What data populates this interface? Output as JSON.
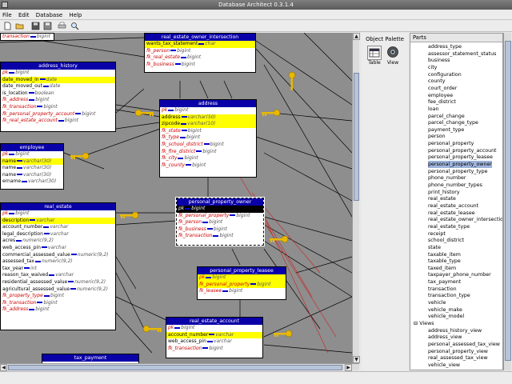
{
  "window": {
    "title": "Database Architect 0.3.1.4"
  },
  "menu": [
    "File",
    "Edit",
    "Database",
    "Help"
  ],
  "palette": {
    "title": "Object Palette",
    "items": [
      {
        "label": "Table",
        "icon": "table-icon"
      },
      {
        "label": "View",
        "icon": "view-icon"
      }
    ]
  },
  "tree": {
    "header": "Parts",
    "tables": [
      "address_type",
      "assessor_statement_status",
      "business",
      "city",
      "configuration",
      "county",
      "court_order",
      "employee",
      "fee_district",
      "loan",
      "parcel_change",
      "parcel_change_type",
      "payment_type",
      "person",
      "personal_property",
      "personal_property_account",
      "personal_property_leasee",
      "personal_property_owner",
      "personal_property_type",
      "phone_number",
      "phone_number_types",
      "print_history",
      "real_estate",
      "real_estate_account",
      "real_estate_leasee",
      "real_estate_owner_intersection",
      "real_estate_type",
      "receipt",
      "school_district",
      "state",
      "taxable_item",
      "taxable_type",
      "taxed_item",
      "taxpayer_phone_number",
      "tax_payment",
      "transaction",
      "transaction_type",
      "vehicle",
      "vehicle_make",
      "vehicle_model"
    ],
    "selected": "personal_property_owner",
    "views_label": "Views",
    "views": [
      "address_history_view",
      "address_view",
      "personal_assessed_tax_view",
      "personal_property_view",
      "real_assessed_tax_view",
      "vehicle_view"
    ]
  },
  "diagram": {
    "tables": [
      {
        "id": "top-left",
        "title": "",
        "rows": [
          {
            "n": "transaction",
            "t": "bigint",
            "k": "fk"
          }
        ]
      },
      {
        "id": "real_estate_owner_intersection",
        "title": "real_estate_owner_intersection",
        "rows": [
          {
            "n": "wants_tax_statement",
            "t": "char",
            "k": "",
            "y": true
          },
          {
            "n": "fk_person",
            "t": "bigint",
            "k": "fk"
          },
          {
            "n": "fk_real_estate",
            "t": "bigint",
            "k": "fk"
          },
          {
            "n": "fk_business",
            "t": "bigint",
            "k": "fk"
          }
        ]
      },
      {
        "id": "address_history",
        "title": "address_history",
        "rows": [
          {
            "n": "pk",
            "t": "bigint",
            "k": "pk"
          },
          {
            "n": "date_moved_in",
            "t": "date",
            "k": "",
            "y": true
          },
          {
            "n": "date_moved_out",
            "t": "date",
            "k": ""
          },
          {
            "n": "is_location",
            "t": "boolean",
            "k": ""
          },
          {
            "n": "fk_address",
            "t": "bigint",
            "k": "fk"
          },
          {
            "n": "fk_transaction",
            "t": "bigint",
            "k": "fk"
          },
          {
            "n": "fk_personal_property_account",
            "t": "bigint",
            "k": "fk"
          },
          {
            "n": "fk_real_estate_account",
            "t": "bigint",
            "k": "fk"
          }
        ]
      },
      {
        "id": "address",
        "title": "address",
        "rows": [
          {
            "n": "pk",
            "t": "bigint",
            "k": "pk"
          },
          {
            "n": "address",
            "t": "varchar(50)",
            "k": "",
            "y": true
          },
          {
            "n": "zipcode",
            "t": "varchar(10)",
            "k": "",
            "y": true
          },
          {
            "n": "fk_state",
            "t": "bigint",
            "k": "fk"
          },
          {
            "n": "fk_type",
            "t": "bigint",
            "k": "fk"
          },
          {
            "n": "fk_school_district",
            "t": "bigint",
            "k": "fk"
          },
          {
            "n": "fk_fire_district",
            "t": "bigint",
            "k": "fk"
          },
          {
            "n": "fk_city",
            "t": "bigint",
            "k": "fk"
          },
          {
            "n": "fk_county",
            "t": "bigint",
            "k": "fk"
          }
        ]
      },
      {
        "id": "employee",
        "title": "employee",
        "rows": [
          {
            "n": "pk",
            "t": "bigint",
            "k": "pk"
          },
          {
            "n": "name",
            "t": "varchar(30)",
            "k": "",
            "y": true
          },
          {
            "n": "name",
            "t": "varchar(30)",
            "k": ""
          },
          {
            "n": "name",
            "t": "varchar(30)",
            "k": ""
          },
          {
            "n": "ername",
            "t": "varchar(30)",
            "k": ""
          }
        ]
      },
      {
        "id": "real_estate",
        "title": "real_estate",
        "rows": [
          {
            "n": "pk",
            "t": "bigint",
            "k": "pk"
          },
          {
            "n": "description",
            "t": "varchar",
            "k": "",
            "y": true
          },
          {
            "n": "account_number",
            "t": "varchar",
            "k": ""
          },
          {
            "n": "legal_description",
            "t": "varchar",
            "k": ""
          },
          {
            "n": "acres",
            "t": "numeric(9,2)",
            "k": ""
          },
          {
            "n": "web_access_pin",
            "t": "varchar",
            "k": ""
          },
          {
            "n": "commercial_assessed_value",
            "t": "numeric(9,2)",
            "k": ""
          },
          {
            "n": "assessed_tax",
            "t": "numeric(9,2)",
            "k": ""
          },
          {
            "n": "tax_year",
            "t": "int",
            "k": ""
          },
          {
            "n": "reason_tax_waived",
            "t": "varchar",
            "k": ""
          },
          {
            "n": "residential_assessed_value",
            "t": "numeric(9,2)",
            "k": ""
          },
          {
            "n": "agricultural_assessed_value",
            "t": "numeric(9,2)",
            "k": ""
          },
          {
            "n": "fk_property_type",
            "t": "bigint",
            "k": "fk"
          },
          {
            "n": "fk_transaction",
            "t": "bigint",
            "k": "fk"
          },
          {
            "n": "fk_address",
            "t": "bigint",
            "k": "fk"
          }
        ]
      },
      {
        "id": "personal_property_owner",
        "title": "personal_property_owner",
        "rows": [
          {
            "n": "pk",
            "t": "bigint",
            "k": "pk",
            "b": true
          },
          {
            "n": "fk_personal_property",
            "t": "bigint",
            "k": "fk"
          },
          {
            "n": "fk_person",
            "t": "bigint",
            "k": "fk"
          },
          {
            "n": "fk_business",
            "t": "bigint",
            "k": "fk"
          },
          {
            "n": "fk_transaction",
            "t": "bigint",
            "k": "fk"
          }
        ]
      },
      {
        "id": "personal_property_leasee",
        "title": "personal_property_leasee",
        "rows": [
          {
            "n": "pk",
            "t": "bigint",
            "k": "pk",
            "y": true
          },
          {
            "n": "fk_personal_property",
            "t": "bigint",
            "k": "fk",
            "y": true
          },
          {
            "n": "fk_leasee",
            "t": "bigint",
            "k": "fk"
          }
        ]
      },
      {
        "id": "real_estate_account",
        "title": "real_estate_account",
        "rows": [
          {
            "n": "pk",
            "t": "bigint",
            "k": "pk"
          },
          {
            "n": "account_number",
            "t": "varchar",
            "k": "",
            "y": true
          },
          {
            "n": "web_access_pin",
            "t": "varchar",
            "k": ""
          },
          {
            "n": "fk_transaction",
            "t": "bigint",
            "k": "fk"
          }
        ]
      },
      {
        "id": "tax_payment",
        "title": "tax_payment",
        "rows": []
      }
    ]
  }
}
